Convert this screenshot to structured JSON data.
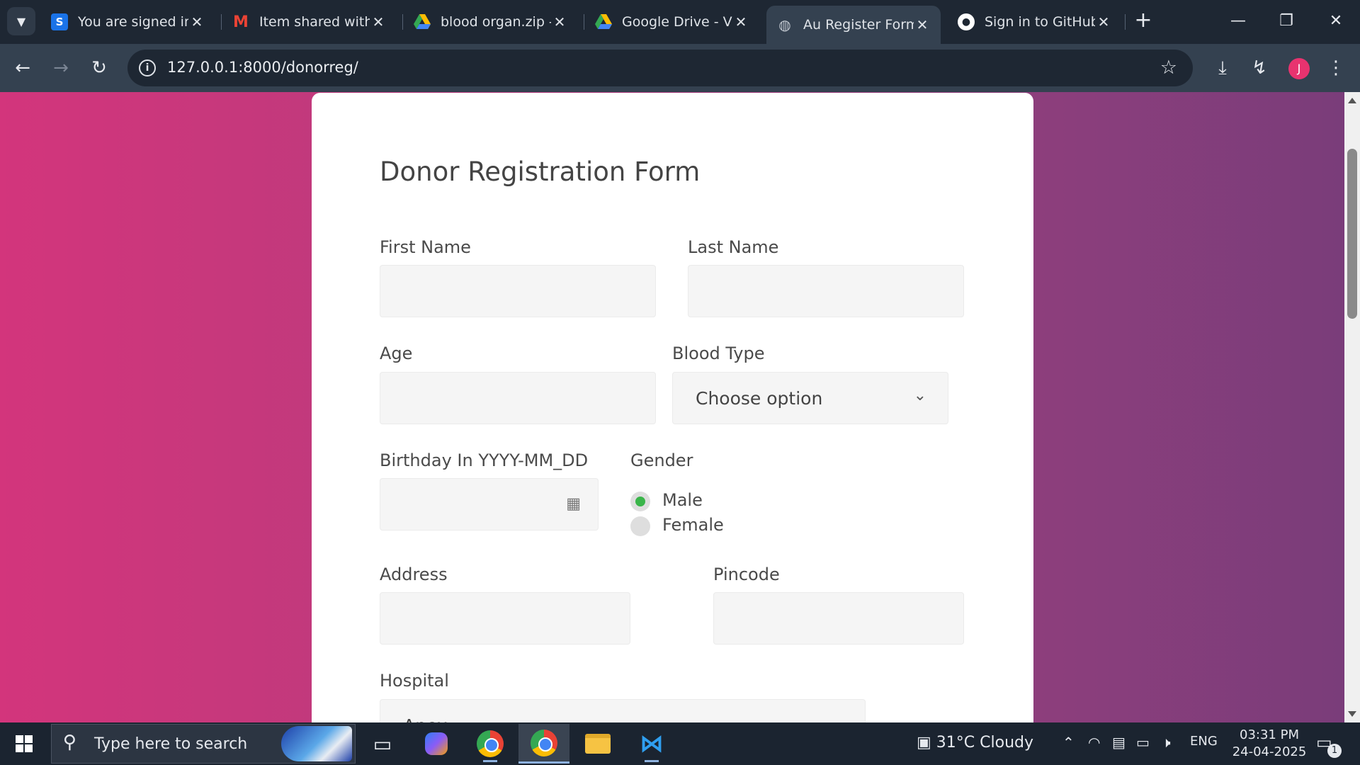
{
  "browser": {
    "tabs": [
      {
        "title": "You are signed in a",
        "icon": "s-icon"
      },
      {
        "title": "Item shared with y",
        "icon": "gmail-icon"
      },
      {
        "title": "blood organ.zip - (",
        "icon": "google-drive-icon"
      },
      {
        "title": "Google Drive - Viru",
        "icon": "google-drive-icon"
      },
      {
        "title": "Au Register Forms",
        "icon": "globe-icon",
        "active": true
      },
      {
        "title": "Sign in to GitHub ·",
        "icon": "github-icon"
      }
    ],
    "url": "127.0.0.1:8000/donorreg/",
    "profile_initial": "J"
  },
  "form": {
    "title": "Donor Registration Form",
    "first_name_label": "First Name",
    "last_name_label": "Last Name",
    "age_label": "Age",
    "blood_type_label": "Blood Type",
    "blood_type_value": "Choose option",
    "birthday_label": "Birthday In YYYY-MM_DD",
    "gender_label": "Gender",
    "gender_options": [
      {
        "label": "Male",
        "selected": true
      },
      {
        "label": "Female",
        "selected": false
      }
    ],
    "address_label": "Address",
    "pincode_label": "Pincode",
    "hospital_label": "Hospital",
    "hospital_value": "Apex"
  },
  "taskbar": {
    "search_placeholder": "Type here to search",
    "weather": "31°C  Cloudy",
    "language": "ENG",
    "time": "03:31 PM",
    "date": "24-04-2025",
    "notification_count": "1"
  },
  "colors": {
    "accent_green": "#3ab54a",
    "page_gradient_start": "#d3357c",
    "page_gradient_end": "#7a3d7a",
    "avatar": "#e8336f"
  }
}
